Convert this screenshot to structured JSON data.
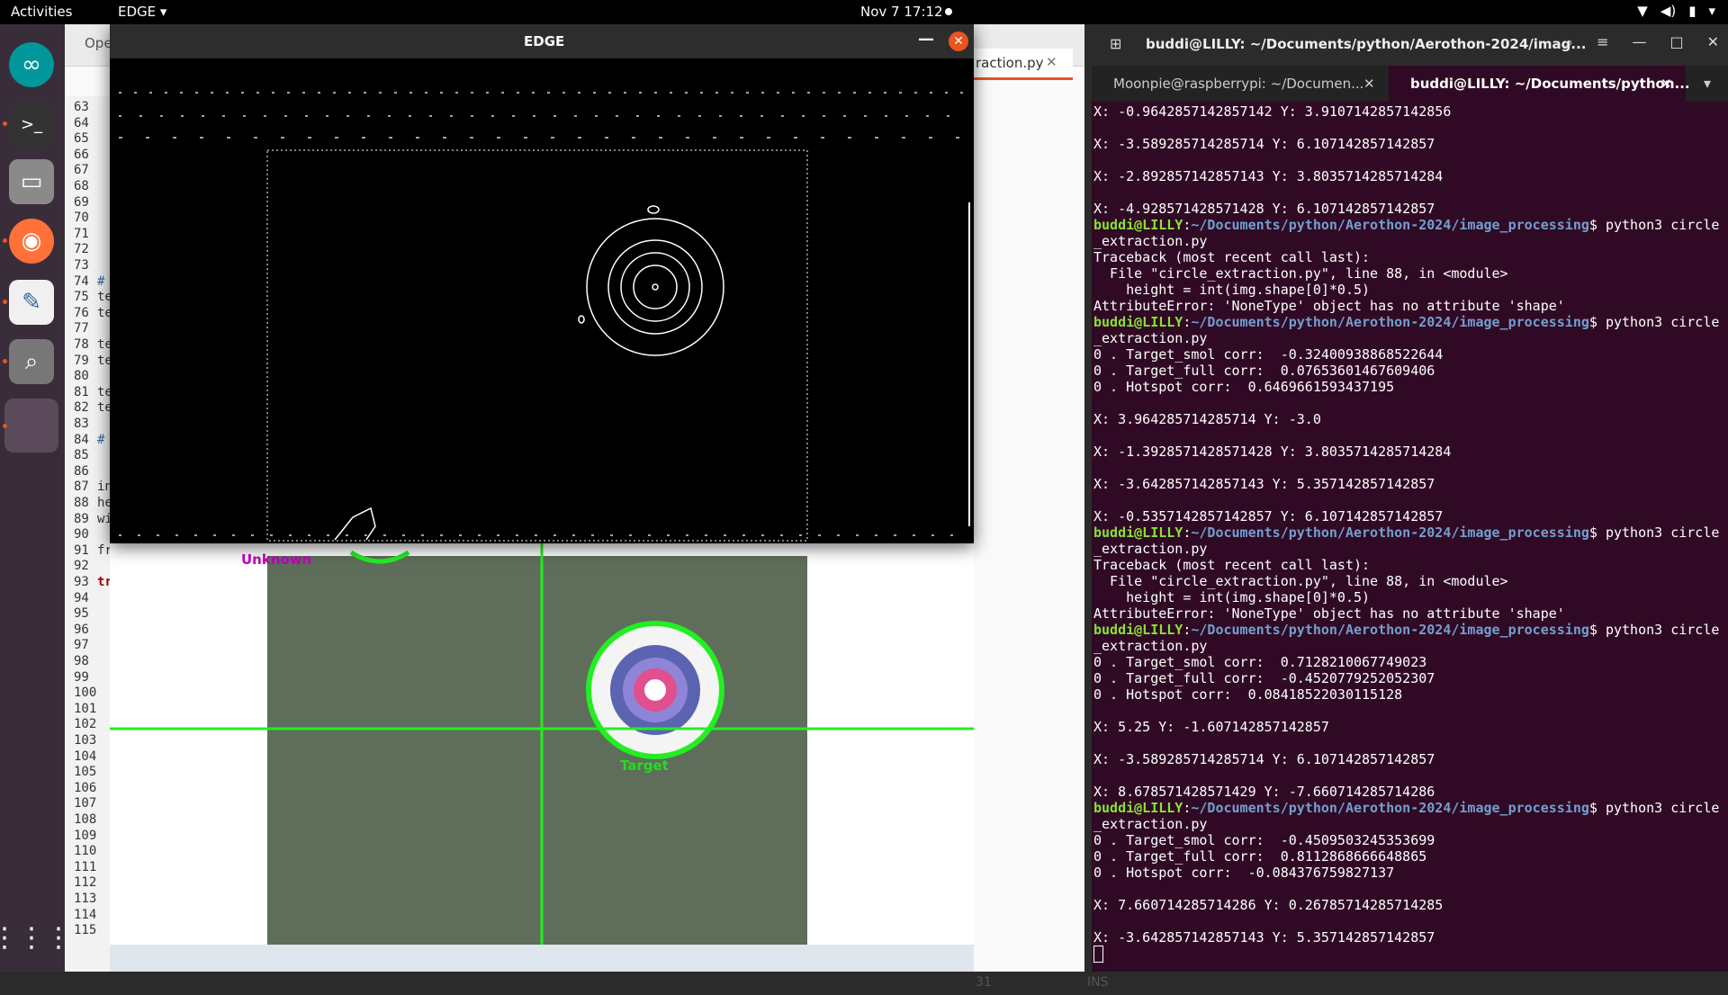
{
  "topbar": {
    "activities": "Activities",
    "app_menu": "EDGE ▾",
    "clock": "Nov 7  17:12"
  },
  "dock": {
    "items": [
      "arduino-icon",
      "terminal-icon",
      "files-icon",
      "firefox-icon",
      "text-editor-icon",
      "image-viewer-icon",
      "active-app"
    ]
  },
  "editor": {
    "partial_tab": "Ope",
    "file_tab": "raction.py",
    "line_numbers": [
      "63",
      "64",
      "65",
      "66",
      "67",
      "68",
      "69",
      "70",
      "71",
      "72",
      "73",
      "74",
      "75",
      "76",
      "77",
      "78",
      "79",
      "80",
      "81",
      "82",
      "83",
      "84",
      "85",
      "86",
      "87",
      "88",
      "89",
      "90",
      "91",
      "92",
      "93",
      "94",
      "95",
      "96",
      "97",
      "98",
      "99",
      "100",
      "101",
      "102",
      "103",
      "104",
      "105",
      "106",
      "107",
      "108",
      "109",
      "110",
      "111",
      "112",
      "113",
      "114",
      "115"
    ],
    "code_fragments": {
      "74": "#",
      "75": "te",
      "76": "te",
      "78": "te",
      "79": "te",
      "81": "te",
      "82": "te",
      "84": "#",
      "87": "in",
      "88": "he",
      "89": "wi",
      "91": "fr",
      "93": "tr"
    },
    "status_line": "31",
    "status_mode": "INS"
  },
  "edge_window": {
    "title": "EDGE"
  },
  "photo": {
    "label_unknown": "Unknown",
    "label_target": "Target"
  },
  "terminal": {
    "title": "buddi@LILLY: ~/Documents/python/Aerothon-2024/imag...",
    "tabs": [
      {
        "label": "Moonpie@raspberrypi: ~/Documen...",
        "active": false
      },
      {
        "label": "buddi@LILLY: ~/Documents/python...",
        "active": true
      }
    ],
    "prompt_user": "buddi@LILLY",
    "prompt_path": "~/Documents/python/Aerothon-2024/image_processing",
    "lines": [
      {
        "t": "X: -0.9642857142857142 Y: 3.9107142857142856"
      },
      {
        "t": ""
      },
      {
        "t": "X: -3.589285714285714 Y: 6.107142857142857"
      },
      {
        "t": ""
      },
      {
        "t": "X: -2.892857142857143 Y: 3.8035714285714284"
      },
      {
        "t": ""
      },
      {
        "t": "X: -4.928571428571428 Y: 6.107142857142857"
      },
      {
        "p": true,
        "cmd": "$ python3 circle"
      },
      {
        "t": "_extraction.py"
      },
      {
        "t": "Traceback (most recent call last):"
      },
      {
        "t": "  File \"circle_extraction.py\", line 88, in <module>"
      },
      {
        "t": "    height = int(img.shape[0]*0.5)"
      },
      {
        "t": "AttributeError: 'NoneType' object has no attribute 'shape'"
      },
      {
        "p": true,
        "cmd": "$ python3 circle"
      },
      {
        "t": "_extraction.py"
      },
      {
        "t": "0 . Target_smol corr:  -0.32400938868522644"
      },
      {
        "t": "0 . Target_full corr:  0.07653601467609406"
      },
      {
        "t": "0 . Hotspot corr:  0.6469661593437195"
      },
      {
        "t": ""
      },
      {
        "t": "X: 3.964285714285714 Y: -3.0"
      },
      {
        "t": ""
      },
      {
        "t": "X: -1.3928571428571428 Y: 3.8035714285714284"
      },
      {
        "t": ""
      },
      {
        "t": "X: -3.642857142857143 Y: 5.357142857142857"
      },
      {
        "t": ""
      },
      {
        "t": "X: -0.5357142857142857 Y: 6.107142857142857"
      },
      {
        "p": true,
        "cmd": "$ python3 circle"
      },
      {
        "t": "_extraction.py"
      },
      {
        "t": "Traceback (most recent call last):"
      },
      {
        "t": "  File \"circle_extraction.py\", line 88, in <module>"
      },
      {
        "t": "    height = int(img.shape[0]*0.5)"
      },
      {
        "t": "AttributeError: 'NoneType' object has no attribute 'shape'"
      },
      {
        "p": true,
        "cmd": "$ python3 circle"
      },
      {
        "t": "_extraction.py"
      },
      {
        "t": "0 . Target_smol corr:  0.7128210067749023"
      },
      {
        "t": "0 . Target_full corr:  -0.4520779252052307"
      },
      {
        "t": "0 . Hotspot corr:  0.08418522030115128"
      },
      {
        "t": ""
      },
      {
        "t": "X: 5.25 Y: -1.607142857142857"
      },
      {
        "t": ""
      },
      {
        "t": "X: -3.589285714285714 Y: 6.107142857142857"
      },
      {
        "t": ""
      },
      {
        "t": "X: 8.678571428571429 Y: -7.660714285714286"
      },
      {
        "p": true,
        "cmd": "$ python3 circle"
      },
      {
        "t": "_extraction.py"
      },
      {
        "t": "0 . Target_smol corr:  -0.4509503245353699"
      },
      {
        "t": "0 . Target_full corr:  0.8112868666648865"
      },
      {
        "t": "0 . Hotspot corr:  -0.084376759827137"
      },
      {
        "t": ""
      },
      {
        "t": "X: 7.660714285714286 Y: 0.26785714285714285"
      },
      {
        "t": ""
      },
      {
        "t": "X: -3.642857142857143 Y: 5.357142857142857"
      }
    ]
  },
  "colors": {
    "accent": "#e95420",
    "terminal_bg": "#300a24",
    "prompt_user": "#8ae234",
    "prompt_path": "#729fcf",
    "crosshair": "#22dd22"
  }
}
